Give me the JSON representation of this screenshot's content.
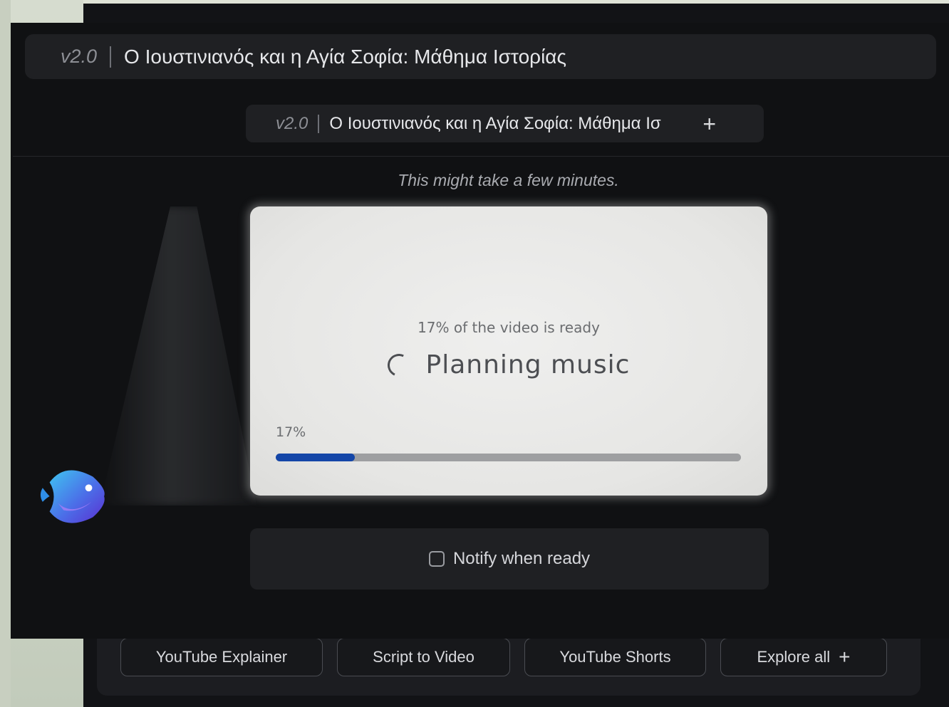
{
  "window": {
    "version": "v2.0",
    "title": "Ο Ιουστινιανός και η Αγία Σοφία: Μάθημα Ιστορίας"
  },
  "tab": {
    "version": "v2.0",
    "title": "Ο Ιουστινιανός και η Αγία Σοφία: Μάθημα Ισ",
    "add_icon": "plus-icon"
  },
  "hint": "This might take a few minutes.",
  "progress_card": {
    "ready_text": "17% of the video is ready",
    "status": "Planning music",
    "percent_label": "17%",
    "progress_fraction": 0.17,
    "fill_color": "#1446a8"
  },
  "notify": {
    "label": "Notify when ready",
    "checked": false
  },
  "templates": [
    {
      "label": "YouTube Explainer"
    },
    {
      "label": "Script to Video"
    },
    {
      "label": "YouTube Shorts"
    },
    {
      "label": "Explore all"
    }
  ],
  "mascot_icon": "fish-mascot-icon"
}
